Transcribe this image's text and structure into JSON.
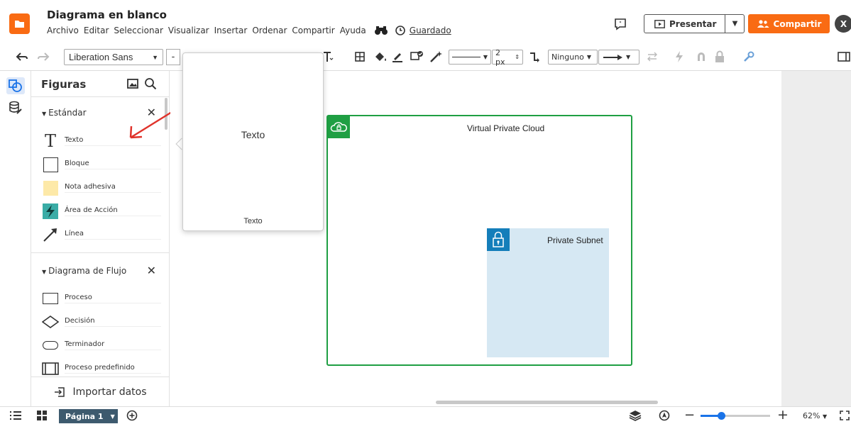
{
  "header": {
    "title": "Diagrama en blanco",
    "menu": [
      "Archivo",
      "Editar",
      "Seleccionar",
      "Visualizar",
      "Insertar",
      "Ordenar",
      "Compartir",
      "Ayuda"
    ],
    "saved_label": "Guardado",
    "present_label": "Presentar",
    "share_label": "Compartir",
    "avatar_letter": "X",
    "accent_color": "#f96b13"
  },
  "toolbar": {
    "font_family": "Liberation Sans",
    "font_minus": "-",
    "line_width": "2 px",
    "endpoint_label": "Ninguno"
  },
  "shapes_panel": {
    "title": "Figuras",
    "sections": [
      {
        "name": "Estándar",
        "items": [
          {
            "label": "Texto",
            "icon": "text-icon"
          },
          {
            "label": "Bloque",
            "icon": "block-icon"
          },
          {
            "label": "Nota adhesiva",
            "icon": "sticky-note-icon"
          },
          {
            "label": "Área de Acción",
            "icon": "action-area-icon"
          },
          {
            "label": "Línea",
            "icon": "line-icon"
          }
        ]
      },
      {
        "name": "Diagrama de Flujo",
        "items": [
          {
            "label": "Proceso",
            "icon": "process-icon"
          },
          {
            "label": "Decisión",
            "icon": "decision-icon"
          },
          {
            "label": "Terminador",
            "icon": "terminator-icon"
          },
          {
            "label": "Proceso predefinido",
            "icon": "predefined-process-icon"
          }
        ]
      }
    ],
    "import_label": "Importar datos"
  },
  "preview": {
    "main_text": "Texto",
    "caption": "Texto"
  },
  "canvas": {
    "vpc_title": "Virtual Private Cloud",
    "vpc_color": "#1f9f43",
    "subnet_title": "Private Subnet",
    "subnet_color": "#147eba",
    "subnet_fill": "#d6e8f3"
  },
  "statusbar": {
    "page_label": "Página 1",
    "zoom_label": "62%",
    "zoom_fraction": 0.3
  }
}
